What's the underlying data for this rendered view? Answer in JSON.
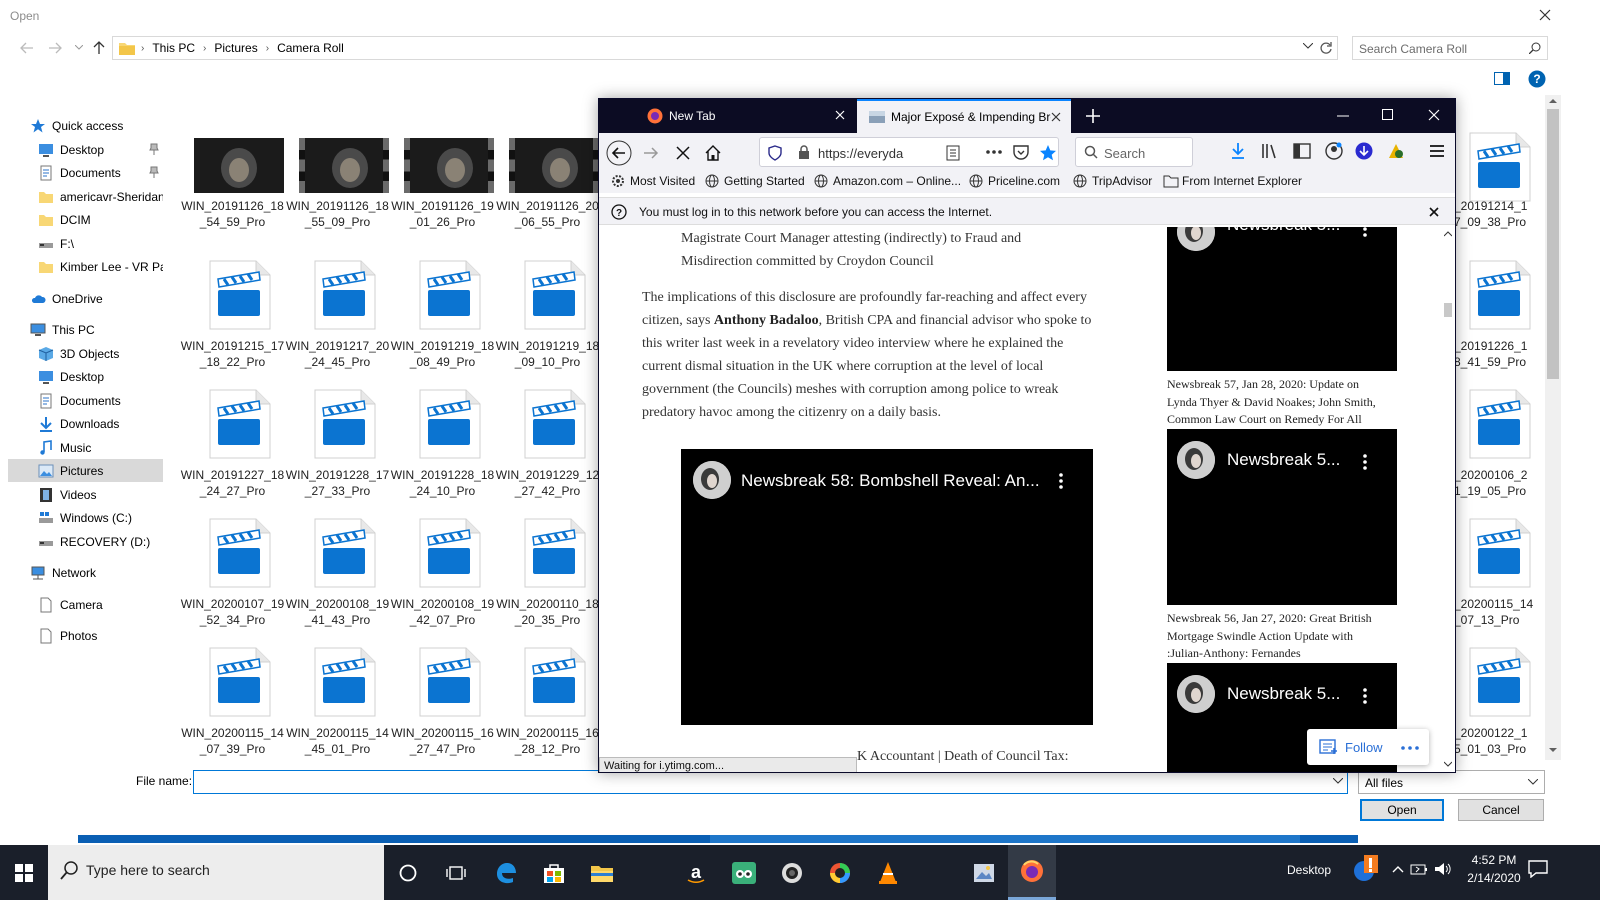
{
  "dialog": {
    "title": "Open",
    "breadcrumbs": [
      "This PC",
      "Pictures",
      "Camera Roll"
    ],
    "search_placeholder": "Search Camera Roll",
    "filename_label": "File name:",
    "filename_value": "",
    "filetype": "All files",
    "open_label": "Open",
    "cancel_label": "Cancel"
  },
  "nav": [
    {
      "label": "Quick access",
      "icon": "star-icon"
    },
    {
      "label": "Desktop",
      "icon": "desktop-folder-icon",
      "pinned": true
    },
    {
      "label": "Documents",
      "icon": "documents-folder-icon",
      "pinned": true
    },
    {
      "label": "americavr-Sheridan",
      "icon": "folder-icon"
    },
    {
      "label": "DCIM",
      "icon": "folder-icon"
    },
    {
      "label": "F:\\",
      "icon": "drive-icon"
    },
    {
      "label": "Kimber Lee - VR Pac",
      "icon": "folder-icon"
    },
    {
      "label": "OneDrive",
      "icon": "cloud-icon"
    },
    {
      "label": "This PC",
      "icon": "computer-icon"
    },
    {
      "label": "3D Objects",
      "icon": "cube-icon"
    },
    {
      "label": "Desktop",
      "icon": "desktop-folder-icon"
    },
    {
      "label": "Documents",
      "icon": "documents-folder-icon"
    },
    {
      "label": "Downloads",
      "icon": "download-arrow-icon"
    },
    {
      "label": "Music",
      "icon": "music-note-icon"
    },
    {
      "label": "Pictures",
      "icon": "pictures-folder-icon",
      "selected": true
    },
    {
      "label": "Videos",
      "icon": "film-icon"
    },
    {
      "label": "Windows (C:)",
      "icon": "windows-drive-icon"
    },
    {
      "label": "RECOVERY (D:)",
      "icon": "drive-icon"
    },
    {
      "label": "Network",
      "icon": "network-icon"
    },
    {
      "label": "Camera",
      "icon": "page-icon"
    },
    {
      "label": "Photos",
      "icon": "page-icon"
    }
  ],
  "files": [
    [
      "WIN_20191126_18_54_59_Pro",
      "WIN_20191126_18_55_09_Pro",
      "WIN_20191126_19_01_26_Pro",
      "WIN_20191126_20_06_55_Pro"
    ],
    [
      "WIN_20191215_17_18_22_Pro",
      "WIN_20191217_20_24_45_Pro",
      "WIN_20191219_18_08_49_Pro",
      "WIN_20191219_18_09_10_Pro"
    ],
    [
      "WIN_20191227_18_24_27_Pro",
      "WIN_20191228_17_27_33_Pro",
      "WIN_20191228_18_24_10_Pro",
      "WIN_20191229_12_27_42_Pro"
    ],
    [
      "WIN_20200107_19_52_34_Pro",
      "WIN_20200108_19_41_43_Pro",
      "WIN_20200108_19_42_07_Pro",
      "WIN_20200110_18_20_35_Pro"
    ],
    [
      "WIN_20200115_14_07_39_Pro",
      "WIN_20200115_14_45_01_Pro",
      "WIN_20200115_16_27_47_Pro",
      "WIN_20200115_16_28_12_Pro"
    ]
  ],
  "right_files": [
    "_20191214_17_09_38_Pro",
    "_20191226_18_41_59_Pro",
    "_20200106_21_19_05_Pro",
    "_20200115_14_07_13_Pro",
    "_20200122_15_01_03_Pro"
  ],
  "firefox": {
    "tab1": "New Tab",
    "tab2": "Major Exposé & Impending Bre",
    "url": "https://everyda",
    "search_placeholder": "Search",
    "bookmarks": [
      "Most Visited",
      "Getting Started",
      "Amazon.com – Online...",
      "Priceline.com",
      "TripAdvisor",
      "From Internet Explorer"
    ],
    "notice": "You must log in to this network before you can access the Internet.",
    "article_top": [
      "Magistrate Court Manager attesting (indirectly) to Fraud and",
      "Misdirection committed by Croydon Council"
    ],
    "article_para": {
      "l1": "The implications of this disclosure are profoundly far-reaching and affect every",
      "l2a": "citizen, says ",
      "l2b": "Anthony Badaloo",
      "l2c": ", British CPA and financial advisor who spoke to",
      "l3": "this writer last week in a revelatory video interview where he explained the",
      "l4": "current dismal situation in the UK where corruption at the level of local",
      "l5": "government (the Councils) meshes with corruption among police to wreak",
      "l6": "predatory havoc among the citizenry on a daily basis."
    },
    "main_video_title": "Newsbreak 58: Bombshell Reveal: An...",
    "side_video_title": "Newsbreak 5...",
    "caption1": [
      "Newsbreak 57, Jan 28, 2020: Update on",
      "Lynda Thyer & David Noakes; John Smith,",
      "Common Law Court on Remedy For All"
    ],
    "caption2": [
      "Newsbreak 56, Jan 27, 2020: Great British",
      "Mortgage Swindle Action Update with",
      ":Julian-Anthony: Fernandes"
    ],
    "bottom_text": "K Accountant | Death of Council Tax:",
    "follow_label": "Follow",
    "status": "Waiting for i.ytimg.com..."
  },
  "taskbar": {
    "search_placeholder": "Type here to search",
    "desktop_label": "Desktop",
    "time": "4:52 PM",
    "date": "2/14/2020"
  },
  "colors": {
    "accent": "#0078d7",
    "firefox_frame": "#0c0c23",
    "taskbar": "#1a1f2a",
    "video_bg": "#000000"
  }
}
